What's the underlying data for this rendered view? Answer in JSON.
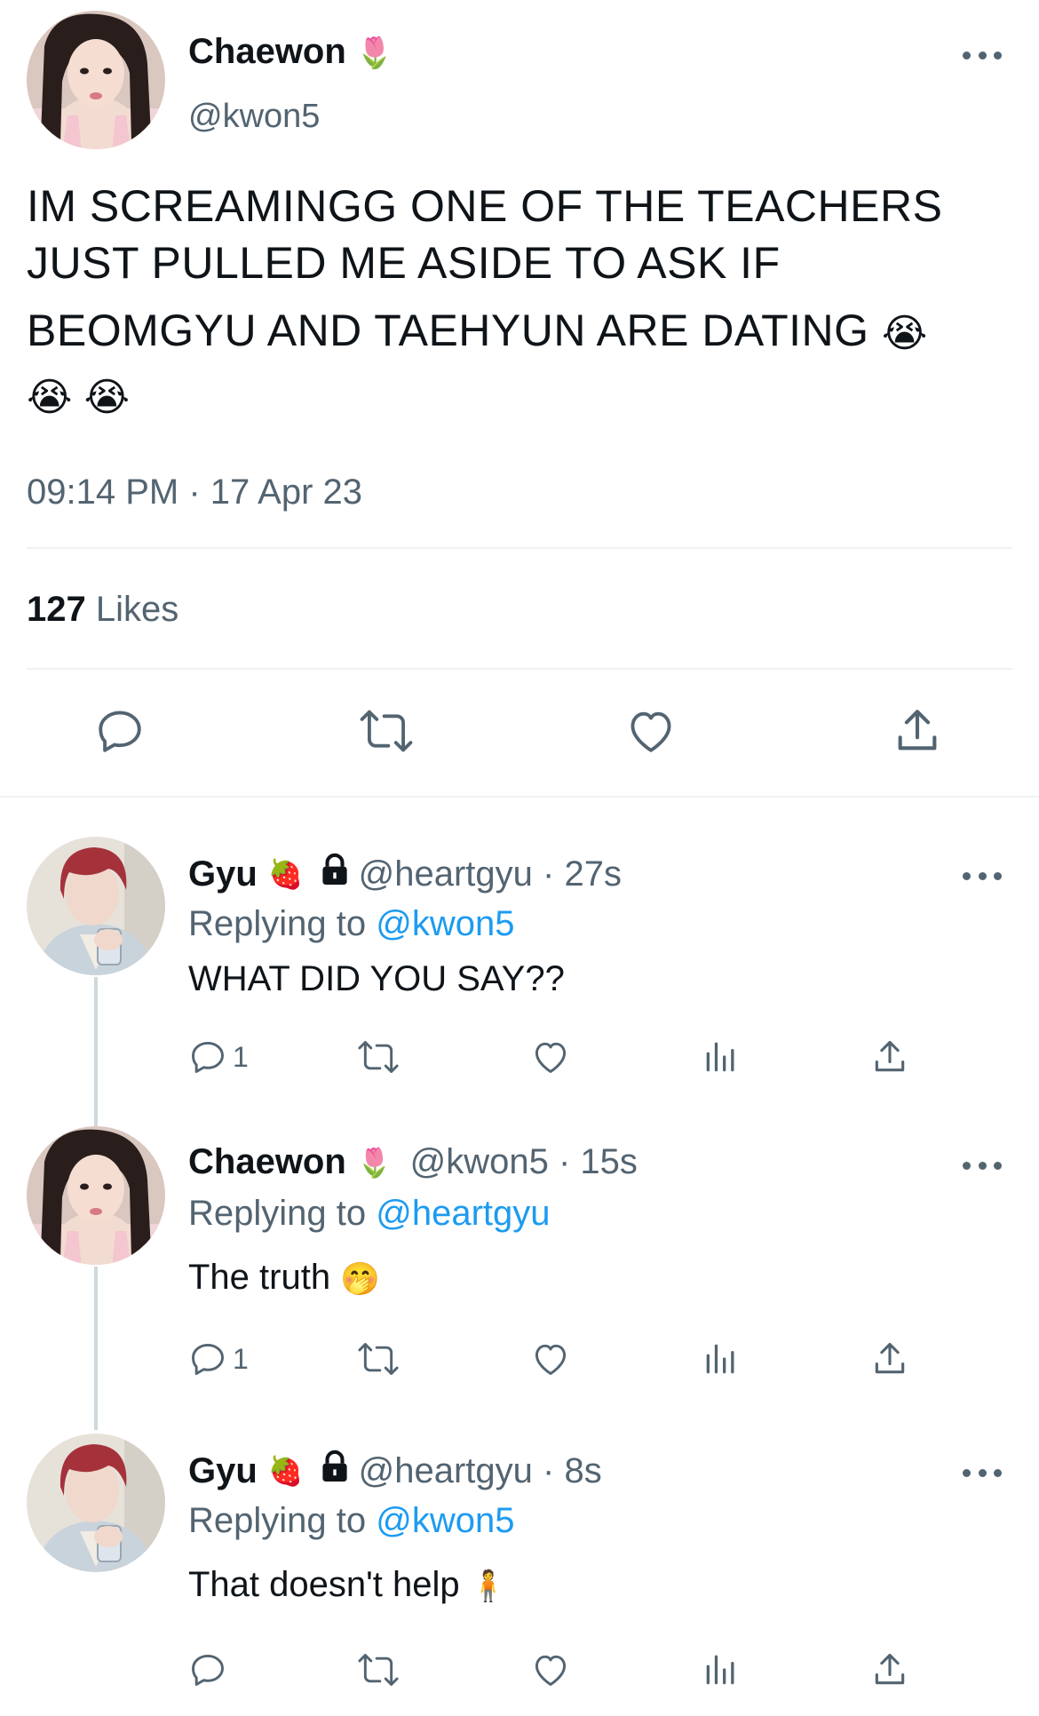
{
  "main_tweet": {
    "author_name": "Chaewon",
    "author_emoji": "🌷",
    "handle": "@kwon5",
    "text_line1": "IM SCREAMINGG ONE OF THE TEACHERS",
    "text_line2": "JUST PULLED ME ASIDE TO ASK IF",
    "text_line3": "BEOMGYU AND TAEHYUN ARE DATING",
    "text_emoji": "😭",
    "timestamp": "09:14 PM · 17 Apr 23",
    "likes_count": "127",
    "likes_label": "Likes",
    "icons": [
      "reply-icon",
      "retweet-icon",
      "like-icon",
      "share-icon"
    ]
  },
  "replies": [
    {
      "author_name": "Gyu",
      "author_emoji": "🍓",
      "locked": true,
      "handle_time": "@heartgyu · 27s",
      "replying_prefix": "Replying to",
      "replying_to": "@kwon5",
      "text": "WHAT DID YOU SAY??",
      "text_emoji": "",
      "reply_count": "1"
    },
    {
      "author_name": "Chaewon",
      "author_emoji": "🌷",
      "locked": false,
      "handle_time": "@kwon5 · 15s",
      "replying_prefix": "Replying to",
      "replying_to": "@heartgyu",
      "text": "The truth",
      "text_emoji": "🤭",
      "reply_count": "1"
    },
    {
      "author_name": "Gyu",
      "author_emoji": "🍓",
      "locked": true,
      "handle_time": "@heartgyu · 8s",
      "replying_prefix": "Replying to",
      "replying_to": "@kwon5",
      "text": "That doesn't help",
      "text_emoji": "🧍",
      "reply_count": ""
    }
  ],
  "colors": {
    "text": "#0f1419",
    "secondary": "#536471",
    "link": "#1d9bf0",
    "divider": "#eff3f4"
  }
}
